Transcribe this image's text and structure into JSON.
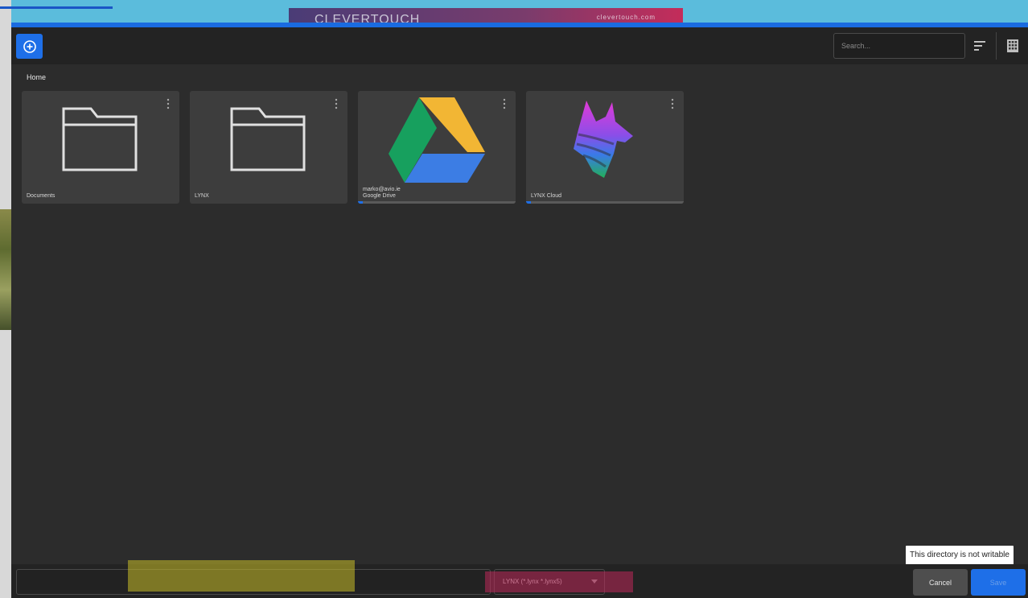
{
  "background": {
    "banner_brand": "CLEVERTOUCH",
    "banner_url": "clevertouch.com"
  },
  "toolbar": {
    "add_icon": "plus-circle-icon",
    "search_placeholder": "Search...",
    "sort_icon": "sort-icon",
    "grid_icon": "grid-view-icon"
  },
  "breadcrumb": "Home",
  "tiles": [
    {
      "label": "Documents",
      "icon": "folder-icon"
    },
    {
      "label": "LYNX",
      "icon": "folder-icon"
    },
    {
      "label": "Google Drive",
      "sub": "marko@avio.ie",
      "icon": "google-drive-icon"
    },
    {
      "label": "LYNX Cloud",
      "icon": "lynx-cloud-icon"
    }
  ],
  "notice": "This directory is not writable",
  "footer": {
    "filename_value": "",
    "filetype": "LYNX (*.lynx *.lynx5)",
    "cancel_label": "Cancel",
    "save_label": "Save"
  },
  "colors": {
    "accent": "#1e6fe8",
    "dialog_bg": "#2c2c2c",
    "tile_bg": "#3d3d3d"
  }
}
